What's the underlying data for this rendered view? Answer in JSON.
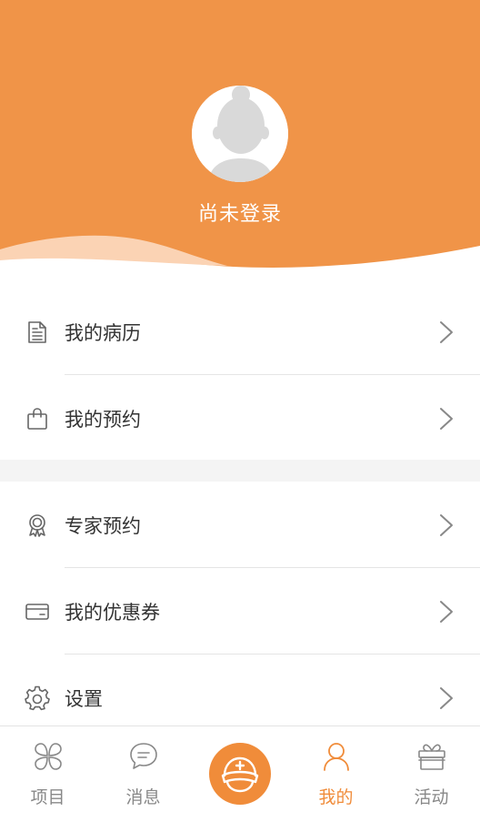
{
  "colors": {
    "accent": "#F08C3A",
    "header_bg": "#F09448",
    "wave_light": "#F9C9A5",
    "text": "#333333",
    "muted": "#888888",
    "divider": "#E5E5E5"
  },
  "header": {
    "login_status": "尚未登录",
    "avatar_icon": "user-avatar-icon"
  },
  "menu": {
    "group1": [
      {
        "label": "我的病历",
        "icon": "document-icon"
      },
      {
        "label": "我的预约",
        "icon": "shopping-bag-icon"
      }
    ],
    "group2": [
      {
        "label": "专家预约",
        "icon": "award-badge-icon"
      },
      {
        "label": "我的优惠券",
        "icon": "card-icon"
      },
      {
        "label": "设置",
        "icon": "gear-icon"
      }
    ]
  },
  "tabbar": {
    "items": [
      {
        "label": "项目",
        "icon": "clover-icon"
      },
      {
        "label": "消息",
        "icon": "chat-bubble-icon"
      },
      {
        "label": "",
        "icon": "nurse-cap-icon"
      },
      {
        "label": "我的",
        "icon": "person-icon",
        "active": true
      },
      {
        "label": "活动",
        "icon": "gift-icon"
      }
    ]
  }
}
